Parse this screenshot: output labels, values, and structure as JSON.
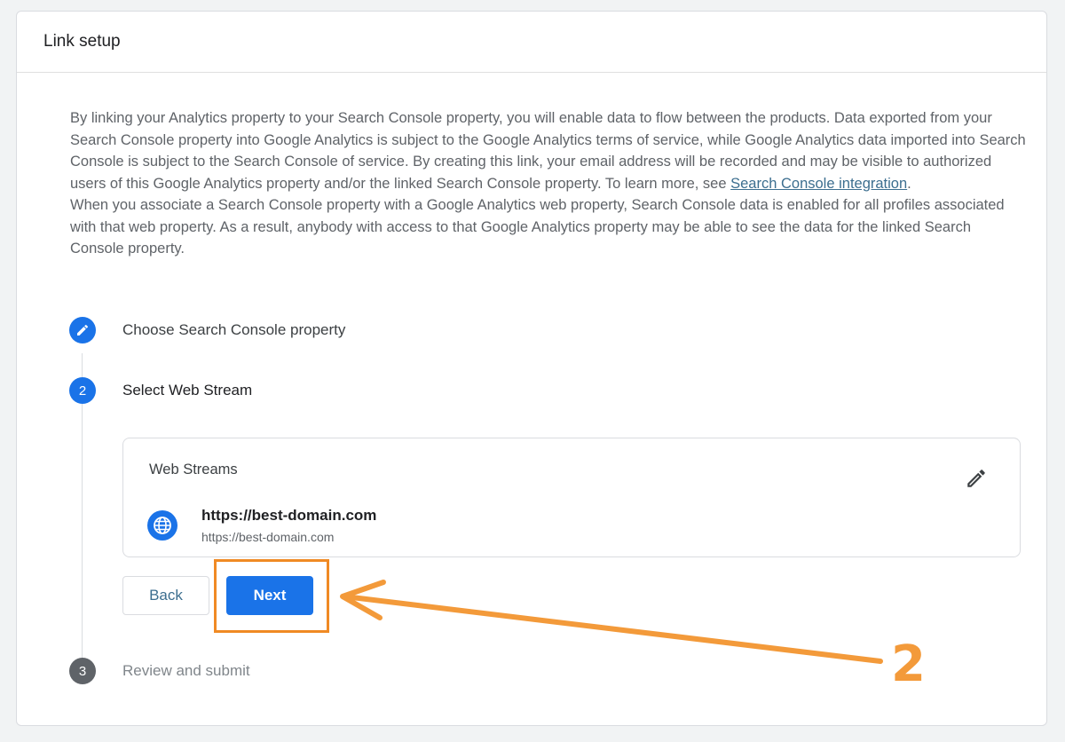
{
  "header": {
    "title": "Link setup"
  },
  "description": {
    "para1": "By linking your Analytics property to your Search Console property, you will enable data to flow between the products. Data exported from your Search Console property into Google Analytics is subject to the Google Analytics terms of service, while Google Analytics data imported into Search Console is subject to the Search Console of service. By creating this link, your email address will be recorded and may be visible to authorized users of this Google Analytics property and/or the linked Search Console property. To learn more, see ",
    "link": "Search Console integration",
    "para1_end": ".",
    "para2": "When you associate a Search Console property with a Google Analytics web property, Search Console data is enabled for all profiles associated with that web property. As a result, anybody with access to that Google Analytics property may be able to see the data for the linked Search Console property."
  },
  "steps": [
    {
      "number": "",
      "icon": "pencil-icon",
      "label": "Choose Search Console property"
    },
    {
      "number": "2",
      "label": "Select Web Stream"
    },
    {
      "number": "3",
      "label": "Review and submit"
    }
  ],
  "web_streams": {
    "title": "Web Streams",
    "url": "https://best-domain.com",
    "url_sub": "https://best-domain.com",
    "icon": "globe-icon",
    "edit_icon": "pencil-icon"
  },
  "buttons": {
    "back": "Back",
    "next": "Next"
  },
  "annotation": {
    "number": "2",
    "color": "#f08a24"
  },
  "colors": {
    "accent": "#1a73e8",
    "muted": "#5f6368"
  }
}
